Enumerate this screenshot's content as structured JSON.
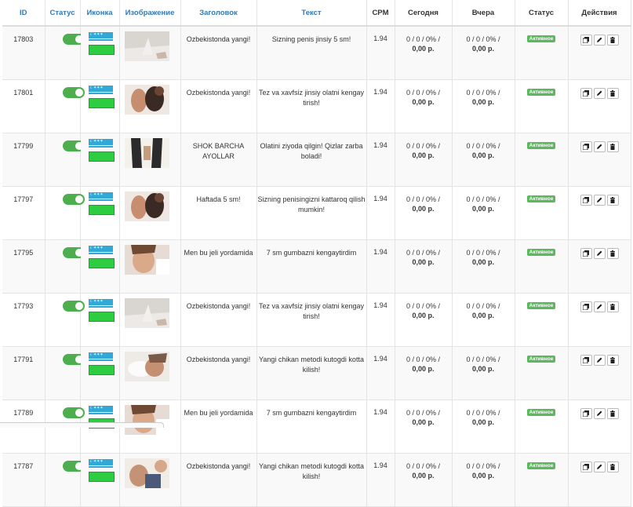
{
  "headers": {
    "id": "ID",
    "status_toggle": "Статус",
    "icon": "Иконка",
    "image": "Изображение",
    "title": "Заголовок",
    "text": "Текст",
    "cpm": "CPM",
    "today": "Сегодня",
    "yesterday": "Вчера",
    "status": "Статус",
    "actions": "Действия"
  },
  "colors": {
    "link": "#337ab7",
    "toggle_on": "#4cae4c",
    "badge": "#5cb85c",
    "flag_blue": "#31a8d6",
    "flag_green": "#2ecc40"
  },
  "rows": [
    {
      "id": "17803",
      "title": "Ozbekistonda yangi!",
      "text": "Sizning penis jinsiy 5 sm!",
      "cpm": "1.94",
      "today_stats": "0 / 0 / 0% /",
      "today_money": "0,00 р.",
      "yesterday_stats": "0 / 0 / 0% /",
      "yesterday_money": "0,00 р.",
      "status": "Активное",
      "toggle_on": true,
      "icon": "uzbekistan-flag-icon",
      "image": "bed-image"
    },
    {
      "id": "17801",
      "title": "Ozbekistonda yangi!",
      "text": "Tez va xavfsiz jinsiy olatni kengay tirish!",
      "cpm": "1.94",
      "today_stats": "0 / 0 / 0% /",
      "today_money": "0,00 р.",
      "yesterday_stats": "0 / 0 / 0% /",
      "yesterday_money": "0,00 р.",
      "status": "Активное",
      "toggle_on": true,
      "icon": "uzbekistan-flag-icon",
      "image": "couple-image"
    },
    {
      "id": "17799",
      "title": "SHOK BARCHA AYOLLAR",
      "text": "Olatini ziyoda qilgin! Qizlar zarba boladi!",
      "cpm": "1.94",
      "today_stats": "0 / 0 / 0% /",
      "today_money": "0,00 р.",
      "yesterday_stats": "0 / 0 / 0% /",
      "yesterday_money": "0,00 р.",
      "status": "Активное",
      "toggle_on": true,
      "icon": "uzbekistan-flag-icon",
      "image": "legs-image"
    },
    {
      "id": "17797",
      "title": "Haftada 5 sm!",
      "text": "Sizning penisingizni kattaroq qilish mumkin!",
      "cpm": "1.94",
      "today_stats": "0 / 0 / 0% /",
      "today_money": "0,00 р.",
      "yesterday_stats": "0 / 0 / 0% /",
      "yesterday_money": "0,00 р.",
      "status": "Активное",
      "toggle_on": true,
      "icon": "uzbekistan-flag-icon",
      "image": "couple-image"
    },
    {
      "id": "17795",
      "title": "Men bu jeli yordamida",
      "text": "7 sm gumbazni kengaytirdim",
      "cpm": "1.94",
      "today_stats": "0 / 0 / 0% /",
      "today_money": "0,00 р.",
      "yesterday_stats": "0 / 0 / 0% /",
      "yesterday_money": "0,00 р.",
      "status": "Активное",
      "toggle_on": true,
      "icon": "uzbekistan-flag-icon",
      "image": "face-image"
    },
    {
      "id": "17793",
      "title": "Ozbekistonda yangi!",
      "text": "Tez va xavfsiz jinsiy olatni kengay tirish!",
      "cpm": "1.94",
      "today_stats": "0 / 0 / 0% /",
      "today_money": "0,00 р.",
      "yesterday_stats": "0 / 0 / 0% /",
      "yesterday_money": "0,00 р.",
      "status": "Активное",
      "toggle_on": true,
      "icon": "uzbekistan-flag-icon",
      "image": "bed-image"
    },
    {
      "id": "17791",
      "title": "Ozbekistonda yangi!",
      "text": "Yangi chikan metodi kutogdi kotta kilish!",
      "cpm": "1.94",
      "today_stats": "0 / 0 / 0% /",
      "today_money": "0,00 р.",
      "yesterday_stats": "0 / 0 / 0% /",
      "yesterday_money": "0,00 р.",
      "status": "Активное",
      "toggle_on": true,
      "icon": "uzbekistan-flag-icon",
      "image": "pillow-image"
    },
    {
      "id": "17789",
      "title": "Men bu jeli yordamida",
      "text": "7 sm gumbazni kengaytirdim",
      "cpm": "1.94",
      "today_stats": "0 / 0 / 0% /",
      "today_money": "0,00 р.",
      "yesterday_stats": "0 / 0 / 0% /",
      "yesterday_money": "0,00 р.",
      "status": "Активное",
      "toggle_on": true,
      "icon": "uzbekistan-flag-icon",
      "image": "face-image"
    },
    {
      "id": "17787",
      "title": "Ozbekistonda yangi!",
      "text": "Yangi chikan metodi kutogdi kotta kilish!",
      "cpm": "1.94",
      "today_stats": "0 / 0 / 0% /",
      "today_money": "0,00 р.",
      "yesterday_stats": "0 / 0 / 0% /",
      "yesterday_money": "0,00 р.",
      "status": "Активное",
      "toggle_on": true,
      "icon": "uzbekistan-flag-icon",
      "image": "man-image"
    }
  ]
}
